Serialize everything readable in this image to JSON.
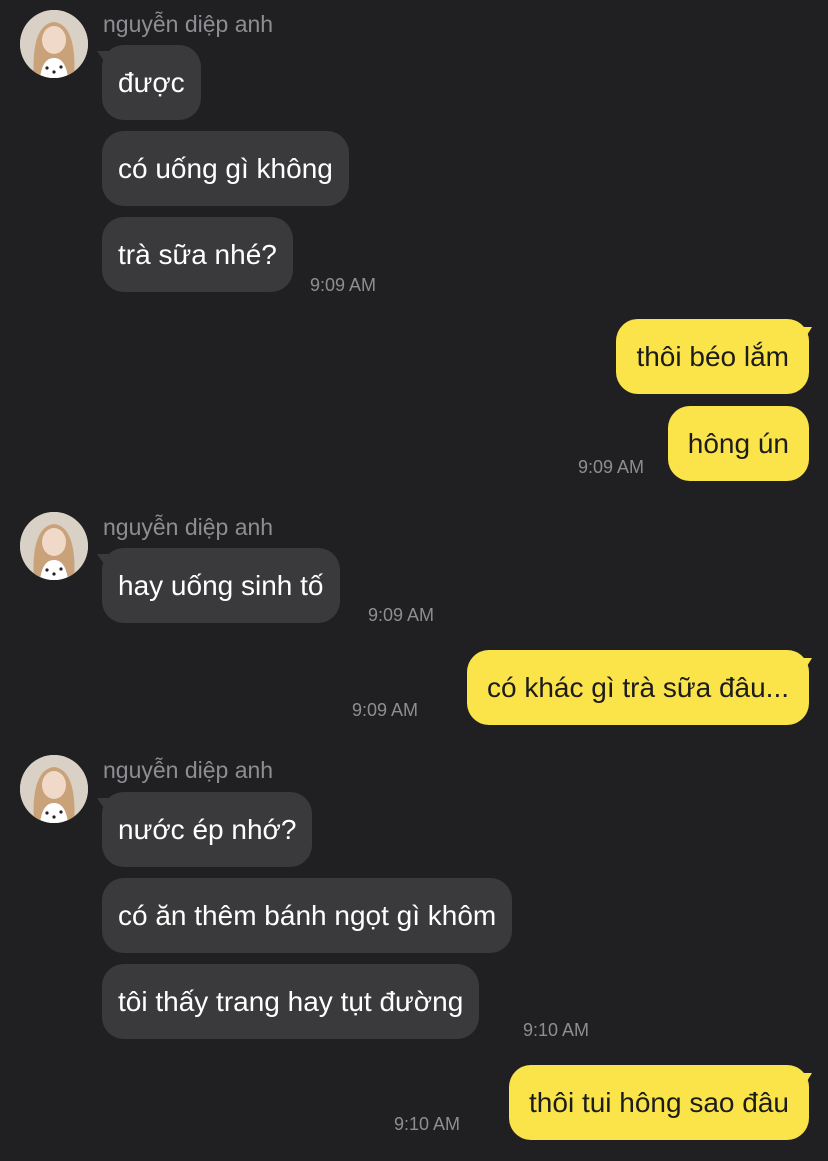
{
  "colors": {
    "background": "#202022",
    "incoming_bubble": "#3a3a3c",
    "outgoing_bubble": "#fbe34a",
    "meta_text": "#8e8e92"
  },
  "groups": [
    {
      "sender": "nguyễn diệp anh",
      "messages": [
        "được",
        "có uống gì không",
        "trà sữa nhé?"
      ],
      "time": "9:09 AM"
    },
    {
      "sender": "me",
      "messages": [
        "thôi béo lắm",
        "hông ún"
      ],
      "time": "9:09 AM"
    },
    {
      "sender": "nguyễn diệp anh",
      "messages": [
        "hay uống sinh tố"
      ],
      "time": "9:09 AM"
    },
    {
      "sender": "me",
      "messages": [
        "có khác gì trà sữa đâu..."
      ],
      "time": "9:09 AM"
    },
    {
      "sender": "nguyễn diệp anh",
      "messages": [
        "nước ép nhớ?",
        "có ăn thêm bánh ngọt gì khôm",
        "tôi thấy trang hay tụt đường"
      ],
      "time": "9:10 AM"
    },
    {
      "sender": "me",
      "messages": [
        "thôi tui hông sao đâu"
      ],
      "time": "9:10 AM"
    }
  ]
}
